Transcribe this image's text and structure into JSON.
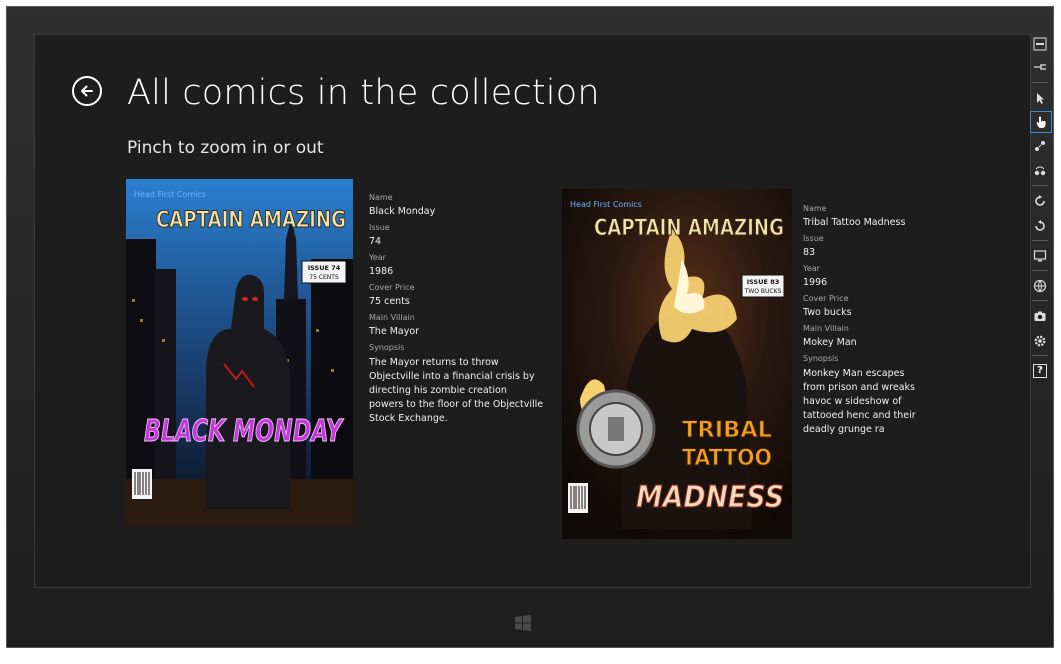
{
  "page": {
    "title": "All comics in the collection",
    "subtitle": "Pinch to zoom in or out"
  },
  "labels": {
    "name": "Name",
    "issue": "Issue",
    "year": "Year",
    "cover_price": "Cover Price",
    "main_villain": "Main Villain",
    "synopsis": "Synopsis"
  },
  "comics": [
    {
      "name": "Black Monday",
      "issue": "74",
      "year": "1986",
      "cover_price": "75 cents",
      "main_villain": "The Mayor",
      "synopsis": "The Mayor returns to throw Objectville into a financial crisis by directing his zombie creation powers to the floor of the Objectville Stock Exchange.",
      "cover": {
        "publisher": "Head First Comics",
        "series": "CAPTAIN AMAZING",
        "issue_badge": [
          "ISSUE 74",
          "75 CENTS"
        ],
        "headline": [
          "BLACK MONDAY"
        ]
      }
    },
    {
      "name": "Tribal Tattoo Madness",
      "issue": "83",
      "year": "1996",
      "cover_price": "Two bucks",
      "main_villain": "Mokey Man",
      "synopsis": "Monkey Man escapes from prison and wreaks havoc w sideshow of tattooed henc and their deadly grunge ra",
      "cover": {
        "publisher": "Head First Comics",
        "series": "CAPTAIN AMAZING",
        "issue_badge": [
          "ISSUE 83",
          "TWO BUCKS"
        ],
        "headline": [
          "TRIBAL",
          "TATTOO",
          "MADNESS"
        ]
      }
    }
  ],
  "toolbar": {
    "icons": [
      "minimize-icon",
      "pin-icon",
      "pointer-icon",
      "touch-icon",
      "pinch-icon",
      "rotate-icon",
      "rotate-clockwise-icon",
      "rotate-counterclockwise-icon",
      "resolution-icon",
      "location-icon",
      "screenshot-icon",
      "settings-icon",
      "help-icon"
    ],
    "help_label": "?"
  },
  "colors": {
    "screen_bg": "#1d1d1d",
    "bezel": "#262626",
    "selected_tool": "#3a87d4"
  }
}
